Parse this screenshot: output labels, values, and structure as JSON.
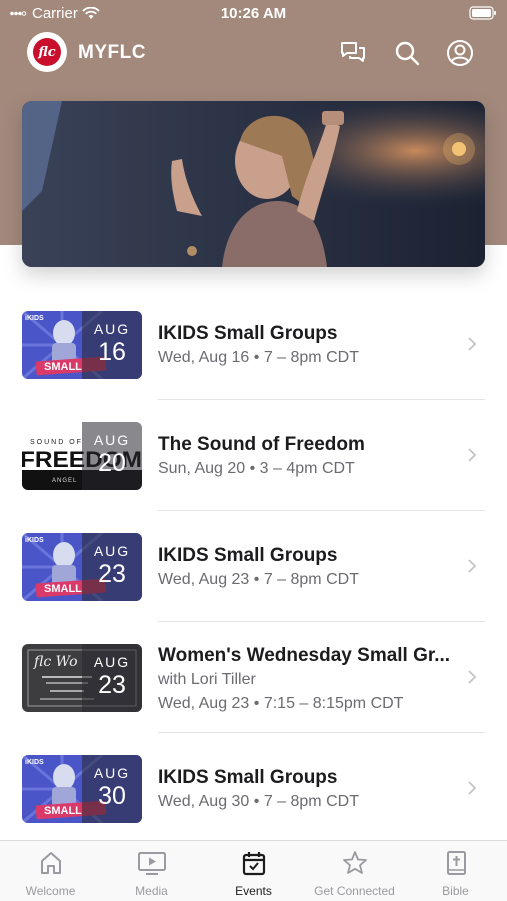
{
  "status_bar": {
    "carrier": "Carrier",
    "time": "10:26 AM"
  },
  "header": {
    "logo_text": "flc",
    "title": "MYFLC"
  },
  "events": [
    {
      "title": "IKIDS Small Groups",
      "subtitle": "",
      "datetime": "Wed, Aug 16 • 7 – 8pm CDT",
      "month": "AUG",
      "day": "16",
      "thumb": "ikids"
    },
    {
      "title": "The Sound of Freedom",
      "subtitle": "",
      "datetime": "Sun, Aug 20 • 3 – 4pm CDT",
      "month": "AUG",
      "day": "20",
      "thumb": "freedom",
      "thumb_text": "FREEDOM",
      "thumb_small": "SOUND OF",
      "thumb_brand": "ANGEL"
    },
    {
      "title": "IKIDS Small Groups",
      "subtitle": "",
      "datetime": "Wed, Aug 23 • 7 – 8pm CDT",
      "month": "AUG",
      "day": "23",
      "thumb": "ikids"
    },
    {
      "title": "Women's Wednesday Small Gr...",
      "subtitle": "with Lori Tiller",
      "datetime": "Wed, Aug 23 • 7:15 – 8:15pm CDT",
      "month": "AUG",
      "day": "23",
      "thumb": "women",
      "thumb_text": "flc Wo"
    },
    {
      "title": "IKIDS Small Groups",
      "subtitle": "",
      "datetime": "Wed, Aug 30 • 7 – 8pm CDT",
      "month": "AUG",
      "day": "30",
      "thumb": "ikids"
    }
  ],
  "ikids_thumb": {
    "badge": "iKIDS",
    "word": "SMALL"
  },
  "tabs": [
    {
      "label": "Welcome",
      "icon": "home-icon",
      "active": false
    },
    {
      "label": "Media",
      "icon": "media-icon",
      "active": false
    },
    {
      "label": "Events",
      "icon": "calendar-icon",
      "active": true
    },
    {
      "label": "Get Connected",
      "icon": "star-icon",
      "active": false
    },
    {
      "label": "Bible",
      "icon": "bible-icon",
      "active": false
    }
  ],
  "colors": {
    "header_bg": "#a3897c",
    "active_tab": "#1c1c1e",
    "inactive_tab": "#9a9aa0",
    "ikids_blue": "#4a55c8"
  }
}
